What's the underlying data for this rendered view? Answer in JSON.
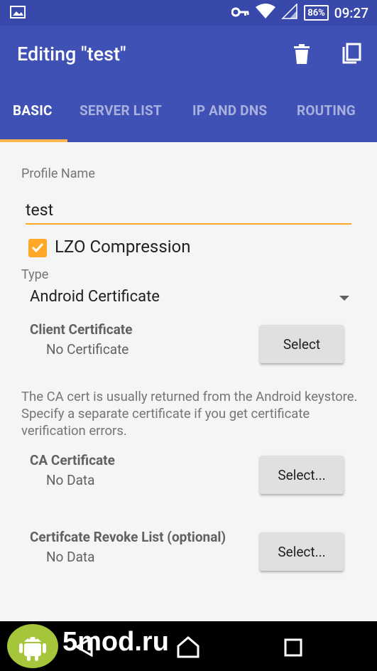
{
  "status_bar": {
    "battery": "86%",
    "time": "09:27"
  },
  "app_bar": {
    "title": "Editing \"test\""
  },
  "tabs": [
    {
      "label": "BASIC",
      "active": true
    },
    {
      "label": "SERVER LIST",
      "active": false
    },
    {
      "label": "IP AND DNS",
      "active": false
    },
    {
      "label": "ROUTING",
      "active": false
    }
  ],
  "form": {
    "profile_name_label": "Profile Name",
    "profile_name_value": "test",
    "lzo_label": "LZO Compression",
    "lzo_checked": true,
    "type_label": "Type",
    "type_value": "Android Certificate",
    "client_cert_title": "Client Certificate",
    "client_cert_value": "No Certificate",
    "client_cert_button": "Select",
    "ca_note": "The CA cert is usually returned from the Android keystore. Specify a separate certificate if you get certificate verification errors.",
    "ca_cert_title": "CA Certificate",
    "ca_cert_value": "No Data",
    "ca_cert_button": "Select...",
    "crl_title": "Certifcate Revoke List (optional)",
    "crl_value": "No Data",
    "crl_button": "Select..."
  },
  "watermark": {
    "text": "5mod.ru"
  },
  "colors": {
    "primary": "#3f51b5",
    "primary_dark": "#3949ab",
    "accent": "#ffa726"
  }
}
